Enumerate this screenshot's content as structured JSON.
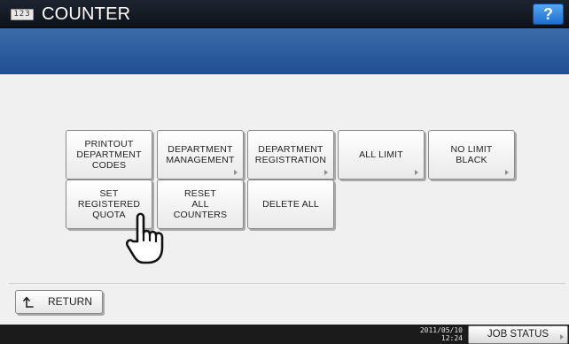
{
  "header": {
    "icon_text": "123",
    "title": "COUNTER",
    "help_label": "?"
  },
  "buttons": {
    "printout_department_codes": "PRINTOUT\nDEPARTMENT\nCODES",
    "department_management": "DEPARTMENT\nMANAGEMENT",
    "department_registration": "DEPARTMENT\nREGISTRATION",
    "all_limit": "ALL LIMIT",
    "no_limit_black": "NO LIMIT\nBLACK",
    "set_registered_quota": "SET\nREGISTERED\nQUOTA",
    "reset_all_counters": "RESET\nALL\nCOUNTERS",
    "delete_all": "DELETE ALL"
  },
  "footer": {
    "return_label": "RETURN",
    "date": "2011/05/10",
    "time": "12:24",
    "job_status_label": "JOB STATUS"
  },
  "colors": {
    "title_bar": "#0d1118",
    "blue_band": "#2a5a9c",
    "panel_bg": "#f0f0f0",
    "help_button": "#2a7fe0"
  },
  "icons": {
    "counter": "counter-123-icon",
    "return": "return-arrow-icon",
    "pointer": "hand-pointer-icon"
  }
}
